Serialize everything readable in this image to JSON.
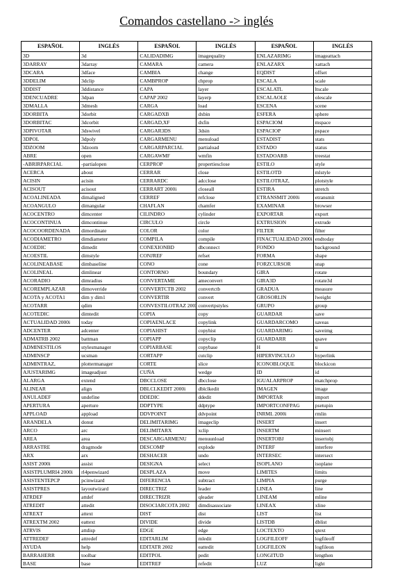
{
  "title": "Comandos castellano -> inglés",
  "headers": [
    "ESPAÑOL",
    "INGLÉS",
    "ESPAÑOL",
    "INGLÉS",
    "ESPAÑOL",
    "INGLÉS"
  ],
  "rows": [
    [
      "3D",
      "3d",
      "CALIDADIMG",
      "imagequality",
      "ENLAZARIMG",
      "imageattach"
    ],
    [
      "3DARRAY",
      "3darray",
      "CAMARA",
      "camera",
      "ENLAZARX",
      "xattach"
    ],
    [
      "3DCARA",
      "3dface",
      "CAMBIA",
      "change",
      "EQDIST",
      "offset"
    ],
    [
      "3DDELIM",
      "3dclip",
      "CAMBPROP",
      "chprop",
      "ESCALA",
      "scale"
    ],
    [
      "3DDIST",
      "3ddistance",
      "CAPA",
      "layer",
      "ESCALATL",
      "ltscale"
    ],
    [
      "3DENCUADRE",
      "3dpan",
      "CAPAP 2002",
      "layerp",
      "ESCALAOLE",
      "olescale"
    ],
    [
      "3DMALLA",
      "3dmesh",
      "CARGA",
      "load",
      "ESCENA",
      "scene"
    ],
    [
      "3DORBITA",
      "3dorbit",
      "CARGADXB",
      "dxbin",
      "ESFERA",
      "sphere"
    ],
    [
      "3DORBITAC",
      "3dcorbit",
      "CARGAD,XF",
      "dxfin",
      "ESPACIOM",
      "mspace"
    ],
    [
      "3DPIVOTAR",
      "3dswivel",
      "CARGAR3DS",
      "3dsin",
      "ESPACIOP",
      "pspace"
    ],
    [
      "3DPOL",
      "3dpoly",
      "CARGARMENU",
      "menuload",
      "ESTADIST",
      "stats"
    ],
    [
      "3DZOOM",
      "3dzoom",
      "CARGARPARCIAL",
      "partiaload",
      "ESTADO",
      "status"
    ],
    [
      "ABRE",
      "open",
      "CARGAWMF",
      "wmfin",
      "ESTADOARB",
      "treestat"
    ],
    [
      "-ABRIRPARCIAL",
      "-partialopen",
      "CERPROP",
      "propertiesclose",
      "ESTILO",
      "style"
    ],
    [
      "ACERCA",
      "about",
      "CERRAR",
      "close",
      "ESTILOTD",
      "mlstyle"
    ],
    [
      "ACISIN",
      "acisin",
      "CERRARDC",
      "adcclose",
      "ESTILOTRAZ,",
      "plotstyle"
    ],
    [
      "ACISOUT",
      "acisout",
      "CERRART 2000i",
      "closeall",
      "ESTIRA",
      "stretch"
    ],
    [
      "ACOALINEADA",
      "dimaligned",
      "CERREF",
      "refclose",
      "ETRANSMIT 2000i",
      "etransmit"
    ],
    [
      "ACOANGULO",
      "dimangular",
      "CHAFLAN",
      "chamfer",
      "EXAMINAR",
      "browser"
    ],
    [
      "ACOCENTRO",
      "dimcenter",
      "CILINDRO",
      "cylinder",
      "EXPORTAR",
      "export"
    ],
    [
      "ACOCONTINUA",
      "dimcontinue",
      "CIRCULO",
      "circle",
      "EXTRUSION",
      "extrude"
    ],
    [
      "ACOCOORDENADA",
      "dimordinate",
      "COLOR",
      "color",
      "FILTER",
      "filter"
    ],
    [
      "ACODIAMETRO",
      "dimdiameter",
      "COMPILA",
      "compile",
      "FINACTUALIDAD 2000i",
      "endtoday"
    ],
    [
      "ACOEDIC",
      "dimedit",
      "CONEXIONBD",
      "dbconnect",
      "FONDO",
      "background"
    ],
    [
      "ACOESTIL",
      "dimstyle",
      "CONJREF",
      "refset",
      "FORMA",
      "shape"
    ],
    [
      "ACOLINEABASE",
      "dimbaseline",
      "CONO",
      "cone",
      "FORZCURSOR",
      "snap"
    ],
    [
      "ACOLINEAL",
      "dimlinear",
      "CONTORNO",
      "boundary",
      "GIRA",
      "rotate"
    ],
    [
      "ACORADIO",
      "dimradius",
      "CONVERTAME",
      "ameconvert",
      "GIRA3D",
      "rotate3d"
    ],
    [
      "ACOREMPLAZAR",
      "dimoverride",
      "CONVERTCTB 2002",
      "convertctb",
      "GRADUA",
      "measure"
    ],
    [
      "ACOTA y ACOTA1",
      "dim y dim1",
      "CONVERTIR",
      "convert",
      "GROSORLIN",
      "lweight"
    ],
    [
      "ACOTARR",
      "qdim",
      "CONVESTILOTRAZ 2002",
      "convertpstyles",
      "GRUPO",
      "group"
    ],
    [
      "ACOTEDIC",
      "dimtedit",
      "COPIA",
      "copy",
      "GUARDAR",
      "save"
    ],
    [
      "ACTUALIDAD 2000i",
      "today",
      "COPIAENLACE",
      "copylink",
      "GUARDARCOMO",
      "saveas"
    ],
    [
      "ADCENTER",
      "adcenter",
      "COPIAHIST",
      "copyhist",
      "GUARDARIMG",
      "saveimg"
    ],
    [
      "ADMATRB 2002",
      "battman",
      "COPIAPP",
      "copyclip",
      "GUARDARR",
      "qsave"
    ],
    [
      "ADMINESTILOS",
      "stylesmanager",
      "COPIARBASE",
      "copybase",
      "H",
      "u"
    ],
    [
      "ADMINSCP",
      "ucsman",
      "CORTAPP",
      "cutclip",
      "HIPERVINCULO",
      "hyperlink"
    ],
    [
      "ADMINTRAZ,",
      "plottermanager",
      "CORTE",
      "slice",
      "ICONOBLOQUE",
      "blockicon"
    ],
    [
      "AJUSTARIMG",
      "imageadjust",
      "CUÑA",
      "wedge",
      "ID",
      "id"
    ],
    [
      "ALARGA",
      "extend",
      "DBCCLOSE",
      "dbcclose",
      "IGUALARPROP",
      "matchprop"
    ],
    [
      "ALINEAR",
      "align",
      "DBLCLKEDIT 2000i",
      "dblclkedit",
      "IMAGEN",
      "image"
    ],
    [
      "ANULADEF",
      "undefine",
      "DDEDIC",
      "ddedit",
      "IMPORTAR",
      "import"
    ],
    [
      "APERTURA",
      "aperture",
      "DDPTYPE",
      "ddptype",
      "IMPORTCONFPAG",
      "psetupin"
    ],
    [
      "APPLOAD",
      "appload",
      "DDVPOINT",
      "ddvpoint",
      "INRML 2000i",
      "rmlin"
    ],
    [
      "ARANDELA",
      "donut",
      "DELIMITARIMG",
      "imageclip",
      "INSERT",
      "insert"
    ],
    [
      "ARCO",
      "arc",
      "DELIMITARX",
      "xclip",
      "INSERTM",
      "minsert"
    ],
    [
      "AREA",
      "area",
      "DESCARGARMENU",
      "menuunload",
      "INSERTOBJ",
      "insertobj"
    ],
    [
      "ARRASTRE",
      "dragmode",
      "DESCOMP",
      "explode",
      "INTERF",
      "interfere"
    ],
    [
      "ARX",
      "arx",
      "DESHACER",
      "undo",
      "INTERSEC",
      "intersect"
    ],
    [
      "ASIST 2000i",
      "assist",
      "DESIGNA",
      "select",
      "ISOPLANO",
      "isoplane"
    ],
    [
      "ASISTPLUMRI4 2000i",
      "rl4penwizard",
      "DESPLAZA",
      "move",
      "LIMITES",
      "limits"
    ],
    [
      "ASISTENTEPCP",
      "pcinwizard",
      "DIFERENCIA",
      "subtract",
      "LIMPIA",
      "purge"
    ],
    [
      "ASISTPRES",
      "layoutwizard",
      "DIRECTRIZ",
      "leader",
      "LINEA",
      "line"
    ],
    [
      "ATRDEF",
      "attdef",
      "DIRECTRIZR",
      "qleader",
      "LINEAM",
      "mline"
    ],
    [
      "ATREDIT",
      "attedit",
      "DISOCIARCOTA 2002",
      "dimdisassociate",
      "LINEAX",
      "xline"
    ],
    [
      "ATREXT",
      "attext",
      "DIST",
      "dist",
      "LIST",
      "list"
    ],
    [
      "ATREXTM 2002",
      "eattext",
      "DIVIDE",
      "divide",
      "LISTDB",
      "dblist"
    ],
    [
      "ATRVIS",
      "attdisp",
      "EDGE",
      "edge",
      "LOCTEXTO",
      "qtext"
    ],
    [
      "ATTREDEF",
      "attredef",
      "EDITARLIM",
      "mledit",
      "LOGFILEOFF",
      "logfileoff"
    ],
    [
      "AYUDA",
      "help",
      "EDITATR 2002",
      "eattedit",
      "LOGFILEON",
      "logfileon"
    ],
    [
      "BARRAHERR",
      "toolbar",
      "EDITPOL",
      "pedit",
      "LONGITUD",
      "lengthen"
    ],
    [
      "BASE",
      "base",
      "EDITREF",
      "refedit",
      "LUZ",
      "light"
    ]
  ]
}
